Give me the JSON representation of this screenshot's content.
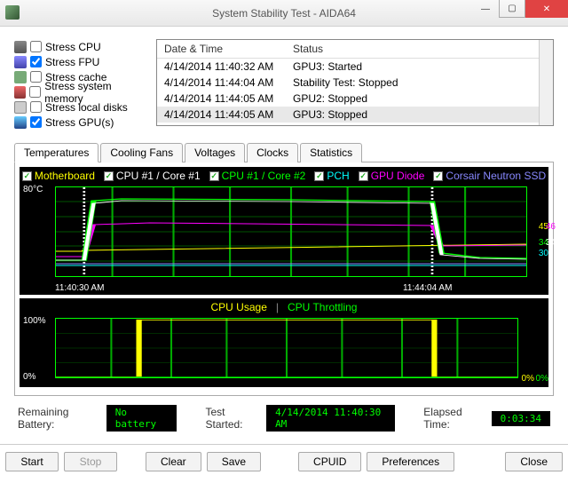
{
  "window": {
    "title": "System Stability Test - AIDA64"
  },
  "stress": [
    {
      "label": "Stress CPU",
      "checked": false,
      "icon": "ico-cpu"
    },
    {
      "label": "Stress FPU",
      "checked": true,
      "icon": "ico-fpu"
    },
    {
      "label": "Stress cache",
      "checked": false,
      "icon": "ico-cache"
    },
    {
      "label": "Stress system memory",
      "checked": false,
      "icon": "ico-mem"
    },
    {
      "label": "Stress local disks",
      "checked": false,
      "icon": "ico-disk"
    },
    {
      "label": "Stress GPU(s)",
      "checked": true,
      "icon": "ico-gpu"
    }
  ],
  "log": {
    "headers": {
      "dt": "Date & Time",
      "status": "Status"
    },
    "rows": [
      {
        "dt": "4/14/2014 11:40:32 AM",
        "status": "GPU3: Started",
        "sel": false
      },
      {
        "dt": "4/14/2014 11:44:04 AM",
        "status": "Stability Test: Stopped",
        "sel": false
      },
      {
        "dt": "4/14/2014 11:44:05 AM",
        "status": "GPU2: Stopped",
        "sel": false
      },
      {
        "dt": "4/14/2014 11:44:05 AM",
        "status": "GPU3: Stopped",
        "sel": true
      }
    ]
  },
  "tabs": [
    {
      "label": "Temperatures",
      "active": true
    },
    {
      "label": "Cooling Fans",
      "active": false
    },
    {
      "label": "Voltages",
      "active": false
    },
    {
      "label": "Clocks",
      "active": false
    },
    {
      "label": "Statistics",
      "active": false
    }
  ],
  "temp_legend": [
    {
      "label": "Motherboard",
      "color": "lc-yellow"
    },
    {
      "label": "CPU #1 / Core #1",
      "color": "lc-white"
    },
    {
      "label": "CPU #1 / Core #2",
      "color": "lc-green"
    },
    {
      "label": "PCH",
      "color": "lc-cyan"
    },
    {
      "label": "GPU Diode",
      "color": "lc-magenta"
    },
    {
      "label": "Corsair Neutron SSD",
      "color": "lc-lblue"
    }
  ],
  "usage_legend": [
    {
      "label": "CPU Usage",
      "color": "lc-yellow"
    },
    {
      "label": "CPU Throttling",
      "color": "lc-green"
    }
  ],
  "chart_data": [
    {
      "type": "line",
      "title": "Temperatures",
      "ylabel": "°C",
      "ylim": [
        20,
        90
      ],
      "y_tick_label": "80°C",
      "x_range_labels": [
        "11:40:30 AM",
        "11:44:04 AM"
      ],
      "events": [
        "start_marker_at_11:40:32",
        "stop_marker_at_11:44:04"
      ],
      "series": [
        {
          "name": "Motherboard",
          "color": "#ffff00",
          "approx_final_value": 45,
          "profile": "flat_low"
        },
        {
          "name": "CPU #1 / Core #1",
          "color": "#ffffff",
          "approx_final_value": 34,
          "profile": "spike_then_drop"
        },
        {
          "name": "CPU #1 / Core #2",
          "color": "#00ff00",
          "approx_final_value": 34,
          "profile": "step_up_plateau_then_drop"
        },
        {
          "name": "PCH",
          "color": "#00ffff",
          "approx_final_value": 30,
          "profile": "flat"
        },
        {
          "name": "GPU Diode",
          "color": "#ff00ff",
          "approx_final_value": 46,
          "profile": "rise_plateau_then_drop"
        },
        {
          "name": "Corsair Neutron SSD",
          "color": "#8888ff",
          "approx_final_value": 30,
          "profile": "flat"
        }
      ],
      "right_value_labels": [
        {
          "text": "45",
          "color": "#ffff00"
        },
        {
          "text": "46",
          "color": "#ff00ff"
        },
        {
          "text": "34",
          "color": "#00ff00"
        },
        {
          "text": "34",
          "color": "#ffffff"
        },
        {
          "text": "30",
          "color": "#00ffff"
        }
      ]
    },
    {
      "type": "line",
      "title": "CPU Usage / Throttling",
      "ylabel": "%",
      "ylim": [
        0,
        100
      ],
      "y_tick_labels": [
        "100%",
        "0%"
      ],
      "series": [
        {
          "name": "CPU Usage",
          "color": "#ffff00",
          "approx_final_value": 0,
          "profile": "step_0_to_100_then_drop"
        },
        {
          "name": "CPU Throttling",
          "color": "#00ff00",
          "approx_final_value": 0,
          "profile": "flat_zero"
        }
      ],
      "right_value_labels": [
        {
          "text": "0%",
          "color": "#ffff00"
        },
        {
          "text": "0%",
          "color": "#00ff00"
        }
      ]
    }
  ],
  "status": {
    "battery_label": "Remaining Battery:",
    "battery_value": "No battery",
    "started_label": "Test Started:",
    "started_value": "4/14/2014 11:40:30 AM",
    "elapsed_label": "Elapsed Time:",
    "elapsed_value": "0:03:34"
  },
  "buttons": {
    "start": "Start",
    "stop": "Stop",
    "clear": "Clear",
    "save": "Save",
    "cpuid": "CPUID",
    "prefs": "Preferences",
    "close": "Close"
  }
}
